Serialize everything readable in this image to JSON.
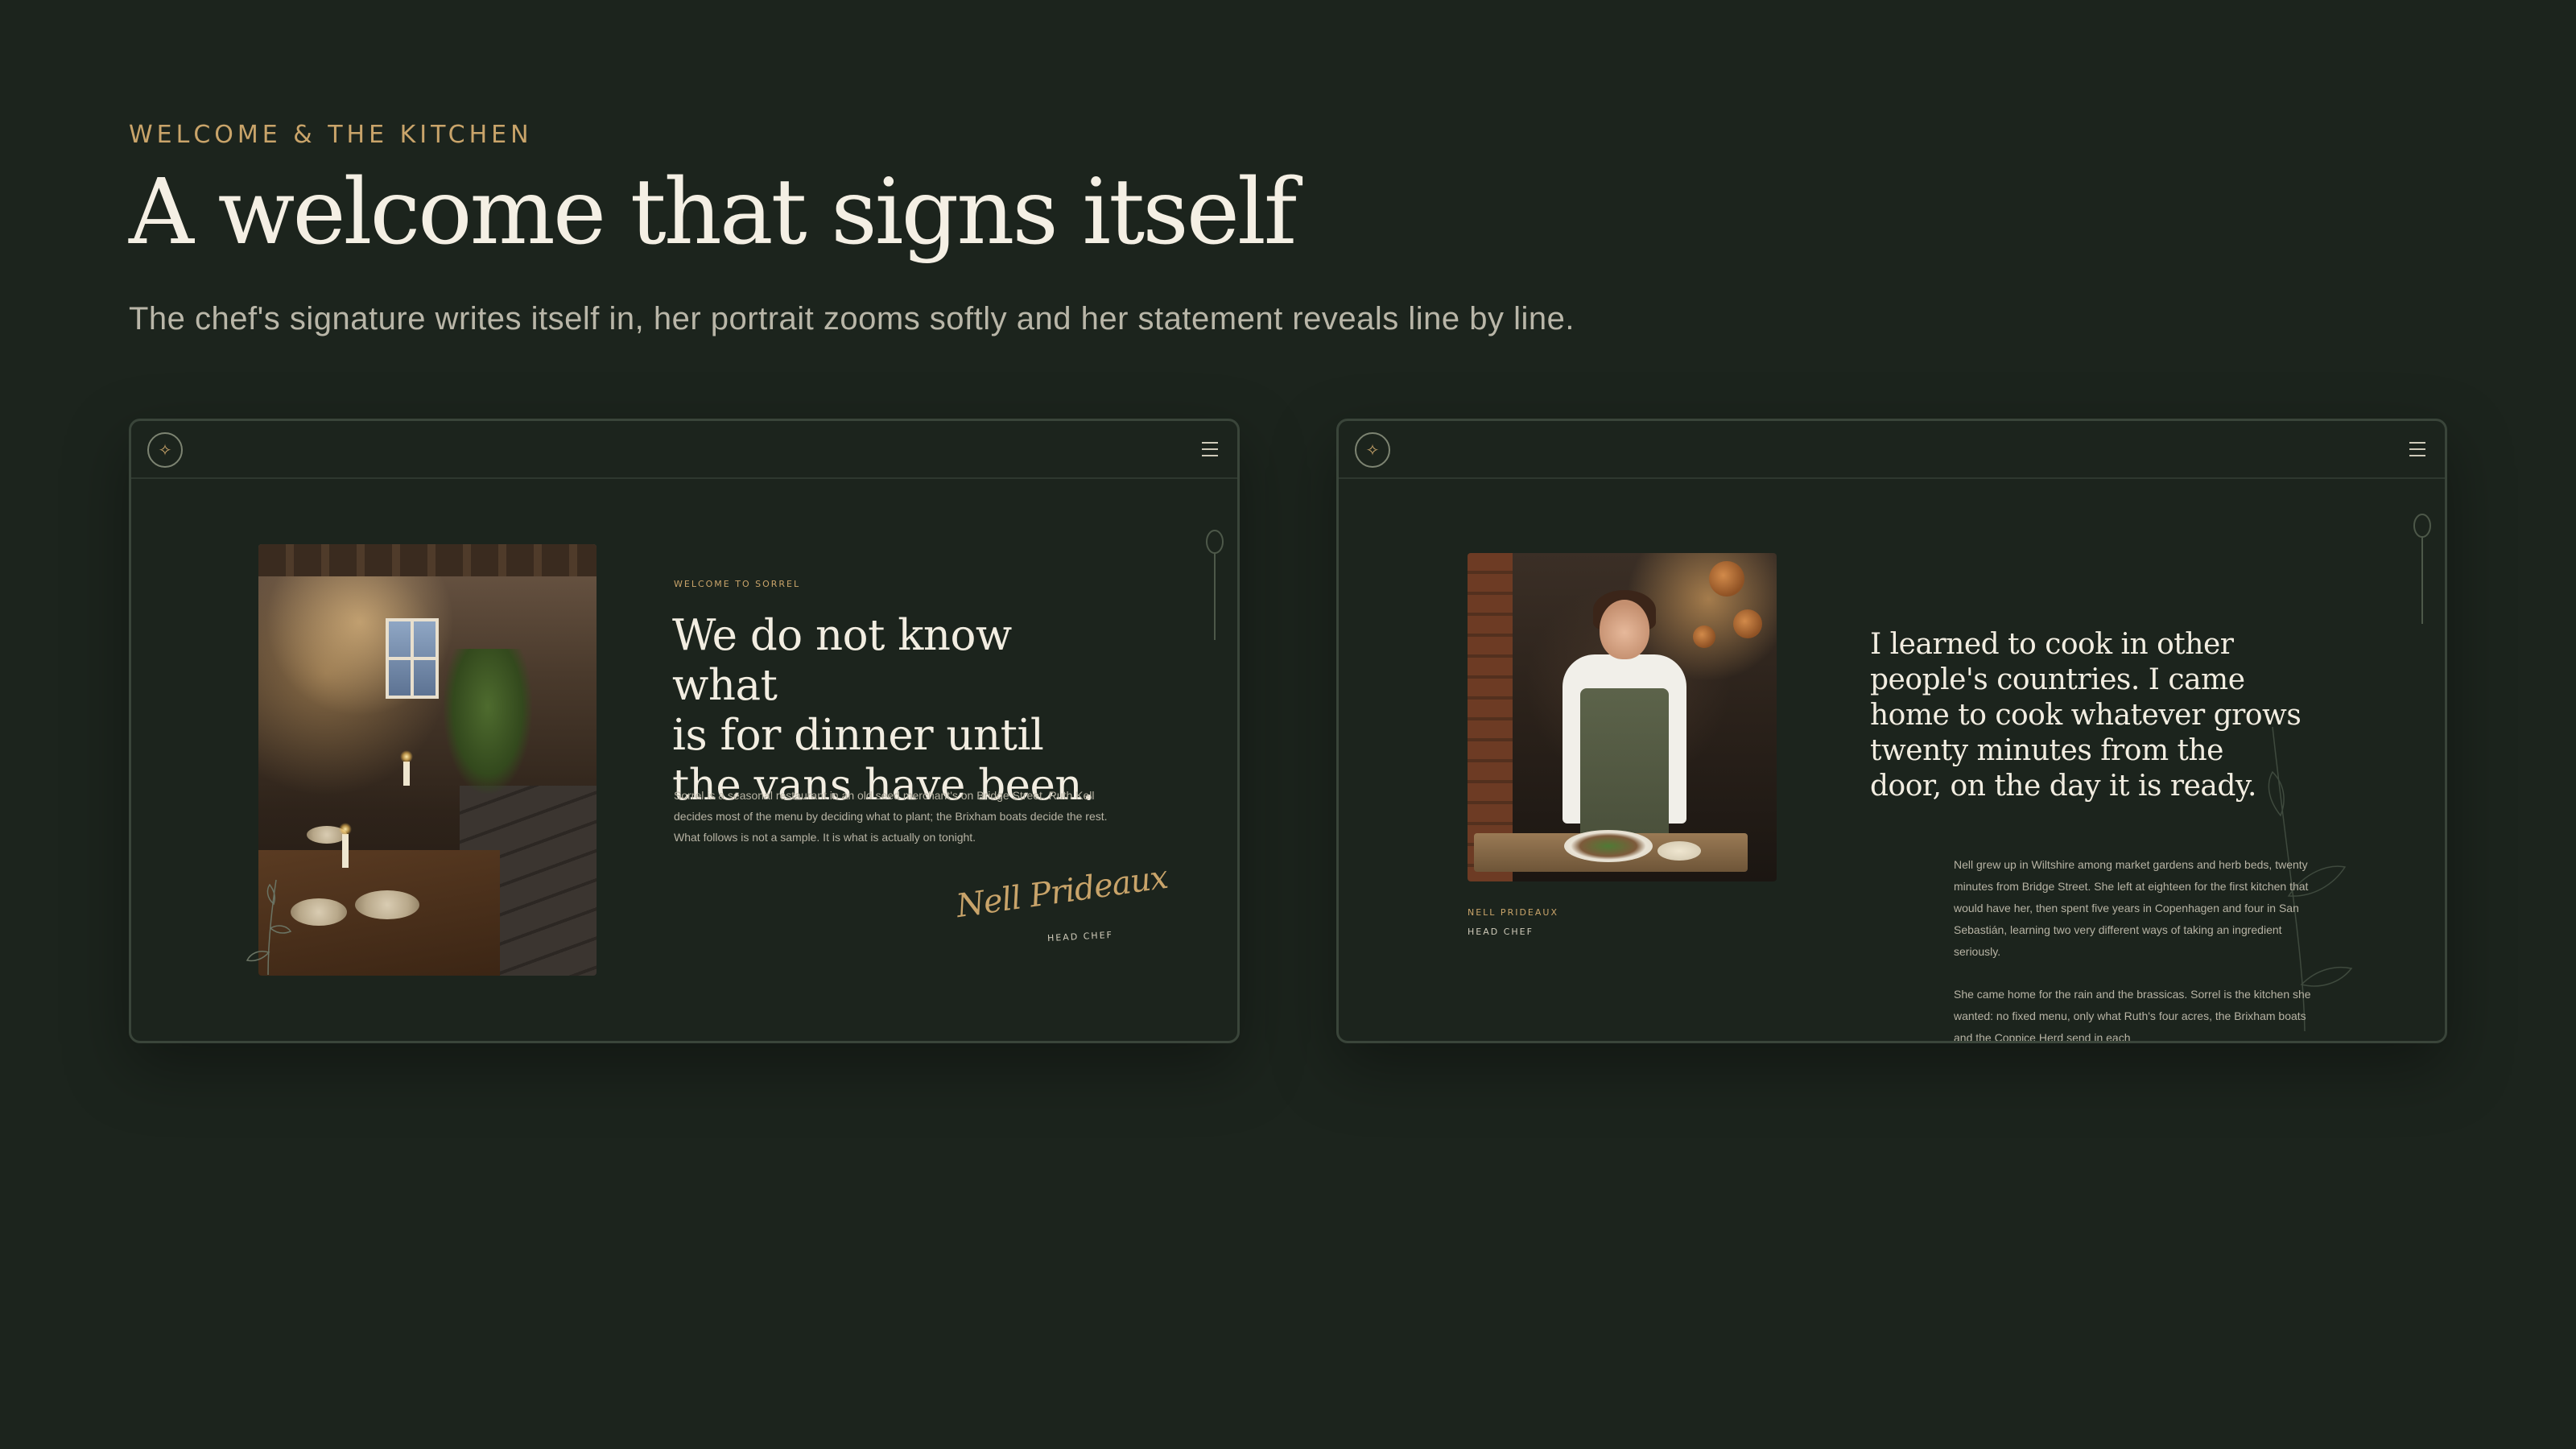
{
  "header": {
    "eyebrow": "WELCOME & THE KITCHEN",
    "title": "A welcome that signs itself",
    "subtitle": "The chef's signature writes itself in, her portrait zooms softly and her statement reveals line by line."
  },
  "left_frame": {
    "logo_glyph": "✧",
    "kicker": "WELCOME TO SORREL",
    "statement_lines": [
      "We do not know what",
      "is for dinner until",
      "the vans have been."
    ],
    "body": "Sorrel is a seasonal restaurant in an old seed merchant's on Bridge Street. Ruth Kell decides most of the menu by deciding what to plant; the Brixham boats decide the rest. What follows is not a sample. It is what is actually on tonight.",
    "signature": "Nell Prideaux",
    "signature_role": "HEAD CHEF"
  },
  "right_frame": {
    "logo_glyph": "✧",
    "chef_name": "NELL PRIDEAUX",
    "chef_role": "HEAD CHEF",
    "quote_lines": [
      "I learned to cook in other",
      "people's countries. I came",
      "home to cook whatever grows",
      "twenty minutes from the",
      "door, on the day it is ready."
    ],
    "bio_paragraphs": [
      "Nell grew up in Wiltshire among market gardens and herb beds, twenty minutes from Bridge Street. She left at eighteen for the first kitchen that would have her, then spent five years in Copenhagen and four in San Sebastián, learning two very different ways of taking an ingredient seriously.",
      "She came home for the rain and the brassicas. Sorrel is the kitchen she wanted: no fixed menu, only what Ruth's four acres, the Brixham boats and the Coppice Herd send in each"
    ]
  },
  "colors": {
    "background": "#1c241d",
    "accent_gold": "#c9a46a",
    "text_light": "#f2ede1",
    "text_muted": "#b7b3a4",
    "frame_border": "#3a453a"
  },
  "icons": [
    "logo-mark-icon",
    "menu-icon",
    "spoon-icon",
    "sprig-icon"
  ]
}
